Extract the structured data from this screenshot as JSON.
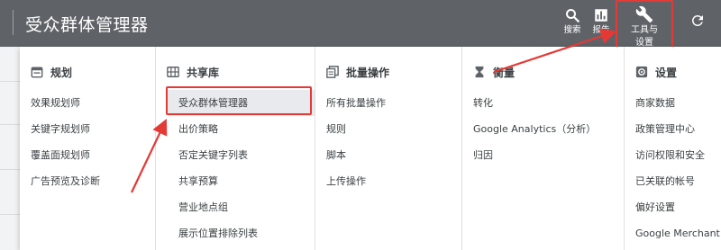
{
  "header": {
    "title": "受众群体管理器",
    "tools": {
      "search_label": "搜索",
      "report_label": "报告",
      "settings_label_line1": "工具与",
      "settings_label_line2": "设置"
    }
  },
  "menu": {
    "columns": [
      {
        "heading": "规划",
        "icon": "calendar-icon",
        "items": [
          "效果规划师",
          "关键字规划师",
          "覆盖面规划师",
          "广告预览及诊断"
        ]
      },
      {
        "heading": "共享库",
        "icon": "grid-icon",
        "items": [
          "受众群体管理器",
          "出价策略",
          "否定关键字列表",
          "共享预算",
          "营业地点组",
          "展示位置排除列表"
        ]
      },
      {
        "heading": "批量操作",
        "icon": "copy-icon",
        "items": [
          "所有批量操作",
          "规则",
          "脚本",
          "上传操作"
        ]
      },
      {
        "heading": "衡量",
        "icon": "hourglass-icon",
        "items": [
          "转化",
          "Google Analytics（分析）",
          "归因"
        ]
      },
      {
        "heading": "设置",
        "icon": "gear-icon",
        "items": [
          "商家数据",
          "政策管理中心",
          "访问权限和安全",
          "已关联的帐号",
          "偏好设置",
          "Google Merchant Center"
        ]
      }
    ]
  },
  "annotation": {
    "color": "#e53935"
  },
  "colors": {
    "topbar": "#5f6368",
    "active_item": "#e8eaed"
  }
}
